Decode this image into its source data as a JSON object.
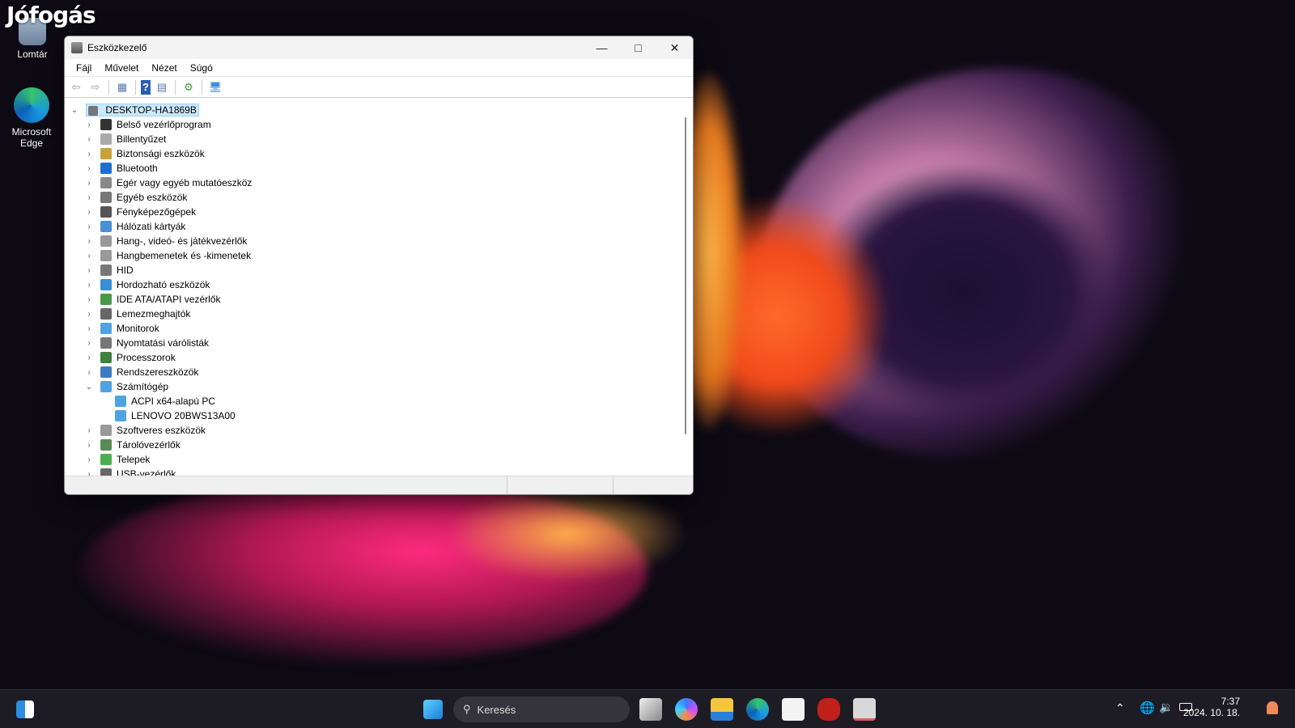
{
  "watermark": "Jófogás",
  "desktop": {
    "icons": [
      {
        "label": "Lomtár",
        "icon": "recycle-bin-icon"
      },
      {
        "label": "Microsoft Edge",
        "icon": "edge-icon"
      }
    ]
  },
  "window": {
    "title": "Eszközkezelő",
    "menu": [
      "Fájl",
      "Művelet",
      "Nézet",
      "Súgó"
    ],
    "toolbar": [
      "back-icon",
      "forward-icon",
      "show-hide-tree-icon",
      "help-icon",
      "properties-icon",
      "update-driver-icon",
      "monitor-icon"
    ],
    "root": "DESKTOP-HA1869B",
    "categories": [
      {
        "label": "Belső vezérlőprogram",
        "color": "#333"
      },
      {
        "label": "Billentyűzet",
        "color": "#aaa"
      },
      {
        "label": "Biztonsági eszközök",
        "color": "#c9a13a"
      },
      {
        "label": "Bluetooth",
        "color": "#1f6fd1"
      },
      {
        "label": "Egér vagy egyéb mutatóeszköz",
        "color": "#888"
      },
      {
        "label": "Egyéb eszközök",
        "color": "#777"
      },
      {
        "label": "Fényképezőgépek",
        "color": "#555"
      },
      {
        "label": "Hálózati kártyák",
        "color": "#4a8fcf"
      },
      {
        "label": "Hang-, videó- és játékvezérlők",
        "color": "#999"
      },
      {
        "label": "Hangbemenetek és -kimenetek",
        "color": "#999"
      },
      {
        "label": "HID",
        "color": "#777"
      },
      {
        "label": "Hordozható eszközök",
        "color": "#3a8ed6"
      },
      {
        "label": "IDE ATA/ATAPI vezérlők",
        "color": "#4a9a4a"
      },
      {
        "label": "Lemezmeghajtók",
        "color": "#666"
      },
      {
        "label": "Monitorok",
        "color": "#4fa3e0"
      },
      {
        "label": "Nyomtatási várólisták",
        "color": "#777"
      },
      {
        "label": "Processzorok",
        "color": "#3f7f3f"
      },
      {
        "label": "Rendszereszközök",
        "color": "#3d7bbf"
      },
      {
        "label": "Számítógép",
        "color": "#4fa3e0",
        "expanded": true,
        "children": [
          "ACPI x64-alapú PC",
          "LENOVO 20BWS13A00"
        ]
      },
      {
        "label": "Szoftveres eszközök",
        "color": "#999"
      },
      {
        "label": "Tárolóvezérlők",
        "color": "#5a8a5a"
      },
      {
        "label": "Telepek",
        "color": "#4caf50"
      },
      {
        "label": "USB-vezérlők",
        "color": "#666"
      }
    ]
  },
  "taskbar": {
    "search_placeholder": "Keresés",
    "apps": [
      "task-view-icon",
      "copilot-icon",
      "file-explorer-icon",
      "edge-icon",
      "store-icon",
      "red-app-icon",
      "device-manager-icon"
    ],
    "time": "7:37",
    "date": "2024. 10. 18."
  }
}
